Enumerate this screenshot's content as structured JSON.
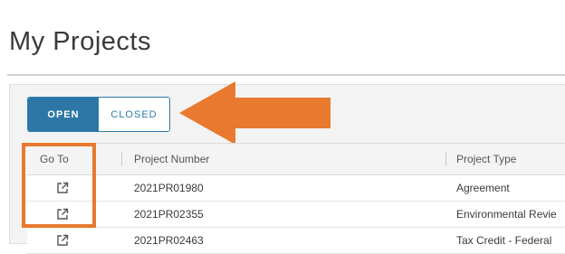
{
  "page": {
    "title": "My Projects"
  },
  "toggle": {
    "open_label": "OPEN",
    "closed_label": "CLOSED",
    "selected": "OPEN"
  },
  "table": {
    "columns": [
      "Go To",
      "Project Number",
      "Project Type"
    ],
    "rows": [
      {
        "project_number": "2021PR01980",
        "project_type": "Agreement"
      },
      {
        "project_number": "2021PR02355",
        "project_type": "Environmental Revie"
      },
      {
        "project_number": "2021PR02463",
        "project_type": "Tax Credit - Federal"
      }
    ]
  },
  "colors": {
    "accent": "#2d77a6",
    "annotation": "#e8792f"
  },
  "icons": {
    "goto": "external-link-icon",
    "arrow": "arrow-left-annotation"
  }
}
